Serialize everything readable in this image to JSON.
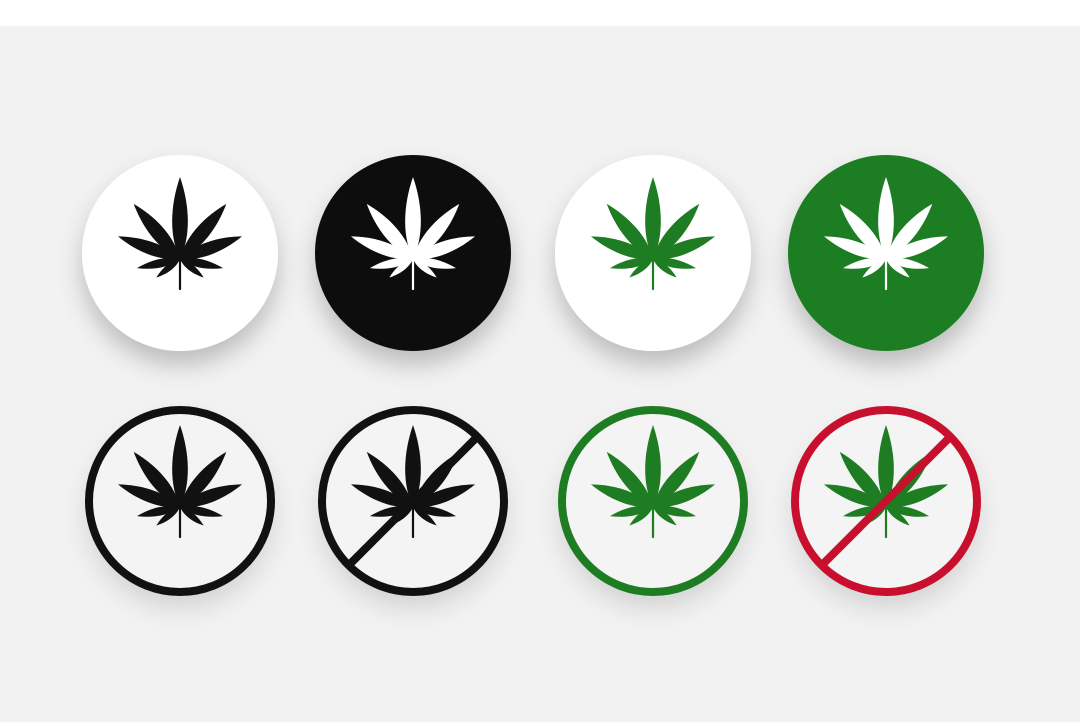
{
  "colors": {
    "background": "#f2f2f2",
    "top_strip": "#ffffff",
    "black": "#111111",
    "white": "#ffffff",
    "green": "#1e7d22",
    "red": "#c8102e"
  },
  "icons": [
    {
      "name": "badge-black-leaf-on-white",
      "style": "filled",
      "fill": "#ffffff",
      "leaf": "#111111"
    },
    {
      "name": "badge-white-leaf-on-black",
      "style": "filled",
      "fill": "#111111",
      "leaf": "#ffffff"
    },
    {
      "name": "badge-green-leaf-on-white",
      "style": "filled",
      "fill": "#ffffff",
      "leaf": "#1e7d22"
    },
    {
      "name": "badge-white-leaf-on-green",
      "style": "filled",
      "fill": "#1e7d22",
      "leaf": "#ffffff"
    },
    {
      "name": "badge-black-leaf-ring",
      "style": "ring",
      "ring": "#111111",
      "leaf": "#111111",
      "slash": false
    },
    {
      "name": "badge-black-leaf-prohibited",
      "style": "ring",
      "ring": "#111111",
      "leaf": "#111111",
      "slash": true
    },
    {
      "name": "badge-green-leaf-ring",
      "style": "ring",
      "ring": "#1e7d22",
      "leaf": "#1e7d22",
      "slash": false
    },
    {
      "name": "badge-green-leaf-prohibited-red",
      "style": "ring",
      "ring": "#c8102e",
      "leaf": "#1e7d22",
      "slash": true
    }
  ]
}
